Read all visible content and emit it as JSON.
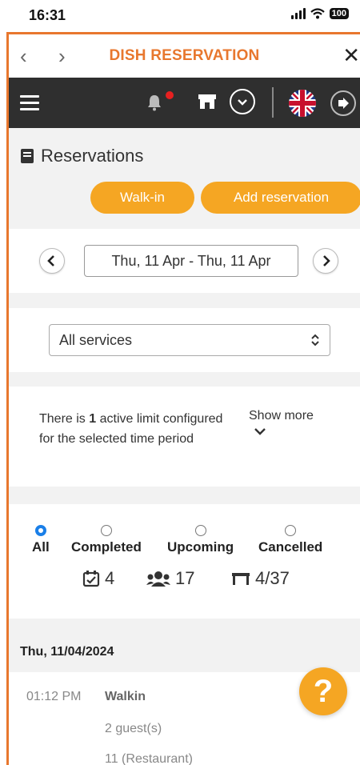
{
  "status_bar": {
    "time": "16:31",
    "battery": "100"
  },
  "topnav": {
    "title": "DISH RESERVATION"
  },
  "page": {
    "title": "Reservations"
  },
  "actions": {
    "walkin_label": "Walk-in",
    "add_label": "Add reservation"
  },
  "date_range": {
    "value": "Thu, 11 Apr - Thu, 11 Apr"
  },
  "services": {
    "selected": "All services"
  },
  "limits": {
    "pre": "There is ",
    "count": "1",
    "post": " active limit configured for the selected time period",
    "show_more": "Show more"
  },
  "filters": [
    {
      "label": "All",
      "selected": true
    },
    {
      "label": "Completed",
      "selected": false
    },
    {
      "label": "Upcoming",
      "selected": false
    },
    {
      "label": "Cancelled",
      "selected": false
    }
  ],
  "stats": {
    "reservations": "4",
    "guests": "17",
    "tables": "4/37"
  },
  "day_header": "Thu, 11/04/2024",
  "reservations": [
    {
      "time": "01:12 PM",
      "name": "Walkin",
      "guests": "2 guest(s)",
      "table": "11 (Restaurant)"
    }
  ],
  "help": {
    "label": "?"
  },
  "colors": {
    "accent": "#e8772e",
    "button": "#f5a623",
    "toolbar": "#2f2f2f",
    "radio_selected": "#1a7fe8"
  }
}
